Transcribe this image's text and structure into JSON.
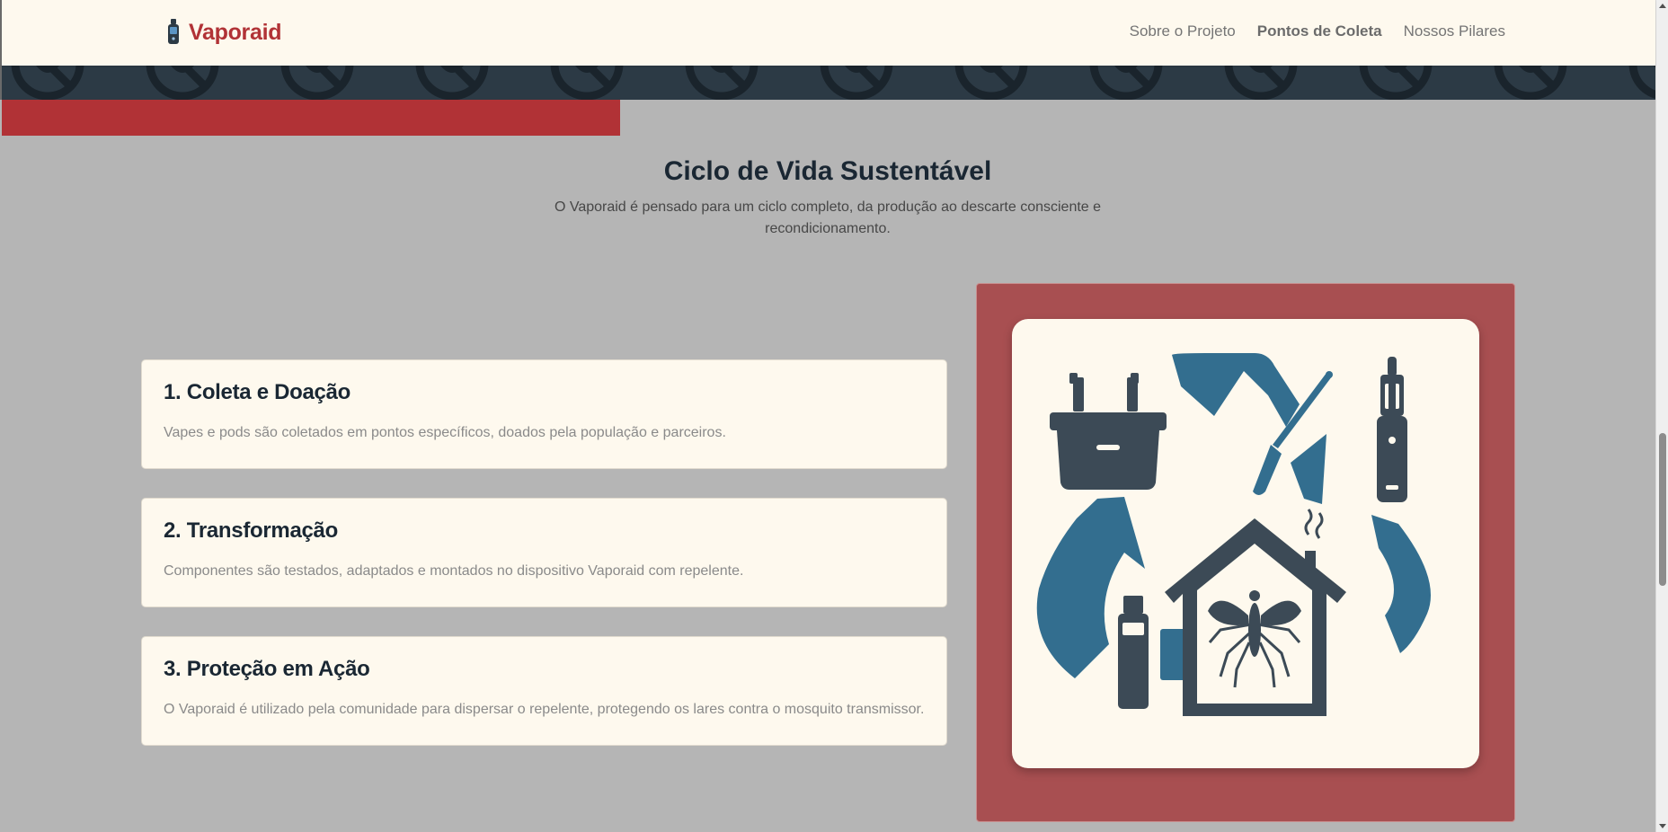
{
  "header": {
    "brand_name": "Vaporaid",
    "nav": [
      {
        "label": "Sobre o Projeto",
        "active": false
      },
      {
        "label": "Pontos de Coleta",
        "active": true
      },
      {
        "label": "Nossos Pilares",
        "active": false
      }
    ]
  },
  "section": {
    "title": "Ciclo de Vida Sustentável",
    "subtitle": "O Vaporaid é pensado para um ciclo completo, da produção ao descarte consciente e recondicionamento."
  },
  "steps": [
    {
      "title": "1. Coleta e Doação",
      "text": "Vapes e pods são coletados em pontos específicos, doados pela população e parceiros."
    },
    {
      "title": "2. Transformação",
      "text": "Componentes são testados, adaptados e montados no dispositivo Vaporaid com repelente."
    },
    {
      "title": "3. Proteção em Ação",
      "text": "O Vaporaid é utilizado pela comunidade para dispersar o repelente, protegendo os lares contra o mosquito transmissor."
    }
  ],
  "illustration": {
    "icons": [
      "collection-basket-icon",
      "screwdriver-icon",
      "vape-device-icon",
      "repellent-bottle-icon",
      "house-mosquito-icon",
      "recycle-arrows-icon"
    ]
  },
  "colors": {
    "brand_red": "#b13236",
    "dark_navy": "#1a2733",
    "teal": "#336e8f",
    "slate": "#3c4a56",
    "cream": "#fef9ee",
    "frame_red": "#a84f51"
  }
}
